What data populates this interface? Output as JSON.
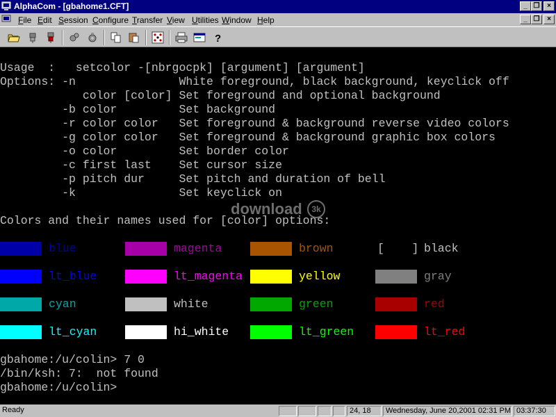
{
  "window": {
    "title": "AlphaCom - [gbahome1.CFT]"
  },
  "menu": {
    "items": [
      "File",
      "Edit",
      "Session",
      "Configure",
      "Transfer",
      "View",
      "Utilities",
      "Window",
      "Help"
    ]
  },
  "terminal": {
    "usage_lines": [
      "Usage  :   setcolor -[nbrgocpk] [argument] [argument]",
      "Options: -n               White foreground, black background, keyclick off",
      "            color [color] Set foreground and optional background",
      "         -b color         Set background",
      "         -r color color   Set foreground & background reverse video colors",
      "         -g color color   Set foreground & background graphic box colors",
      "         -o color         Set border color",
      "         -c first last    Set cursor size",
      "         -p pitch dur     Set pitch and duration of bell",
      "         -k               Set keyclick on"
    ],
    "colors_heading": "Colors and their names used for [color] options:",
    "colors": [
      {
        "name": "blue",
        "swatch": "#0000a8",
        "text": "#0000a8"
      },
      {
        "name": "magenta",
        "swatch": "#a800a8",
        "text": "#a800a8"
      },
      {
        "name": "brown",
        "swatch": "#a85400",
        "text": "#a85400"
      },
      {
        "name": "black",
        "swatch": "#000000",
        "text": "#c0c0c0",
        "bracket": "[    ]"
      },
      {
        "name": "lt_blue",
        "swatch": "#0000ff",
        "text": "#0000ff"
      },
      {
        "name": "lt_magenta",
        "swatch": "#ff00ff",
        "text": "#ff00ff"
      },
      {
        "name": "yellow",
        "swatch": "#ffff00",
        "text": "#ffff00"
      },
      {
        "name": "gray",
        "swatch": "#808080",
        "text": "#808080"
      },
      {
        "name": "cyan",
        "swatch": "#00a8a8",
        "text": "#00a8a8"
      },
      {
        "name": "white",
        "swatch": "#c0c0c0",
        "text": "#c0c0c0"
      },
      {
        "name": "green",
        "swatch": "#00a800",
        "text": "#00a800"
      },
      {
        "name": "red",
        "swatch": "#a80000",
        "text": "#a80000"
      },
      {
        "name": "lt_cyan",
        "swatch": "#00ffff",
        "text": "#00ffff"
      },
      {
        "name": "hi_white",
        "swatch": "#ffffff",
        "text": "#ffffff"
      },
      {
        "name": "lt_green",
        "swatch": "#00ff00",
        "text": "#00ff00"
      },
      {
        "name": "lt_red",
        "swatch": "#ff0000",
        "text": "#ff0000"
      }
    ],
    "prompt_lines": [
      "gbahome:/u/colin> 7 0",
      "/bin/ksh: 7:  not found",
      "gbahome:/u/colin>"
    ]
  },
  "watermark": {
    "text": "download",
    "badge": "3k"
  },
  "status": {
    "ready": "Ready",
    "position": "24, 18",
    "datetime": "Wednesday, June 20,2001  02:31 PM",
    "elapsed": "03:37:30"
  },
  "colors": {
    "titlebar": "#000080",
    "chrome": "#c0c0c0",
    "terminal_bg": "#000000"
  }
}
